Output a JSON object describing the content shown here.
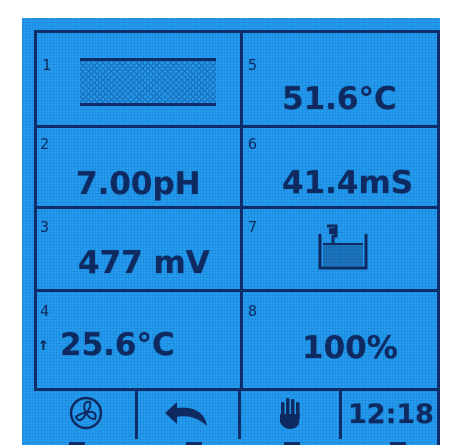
{
  "panel": {
    "cells": [
      {
        "id": "1",
        "value": ""
      },
      {
        "id": "2",
        "value": "7.00pH"
      },
      {
        "id": "3",
        "value": "477 mV"
      },
      {
        "id": "4",
        "value": "25.6°C",
        "marker": "↑"
      },
      {
        "id": "5",
        "value": "51.6°C"
      },
      {
        "id": "6",
        "value": "41.4mS"
      },
      {
        "id": "7",
        "value": ""
      },
      {
        "id": "8",
        "value": "100%"
      }
    ]
  },
  "toolbar": {
    "buttons": [
      {
        "icon": "fan-icon"
      },
      {
        "icon": "undo-arrow-icon"
      },
      {
        "icon": "hand-icon"
      }
    ],
    "clock": "12:18"
  },
  "colors": {
    "lcd_background": "#229bf0",
    "lcd_foreground": "#0f2a60"
  }
}
